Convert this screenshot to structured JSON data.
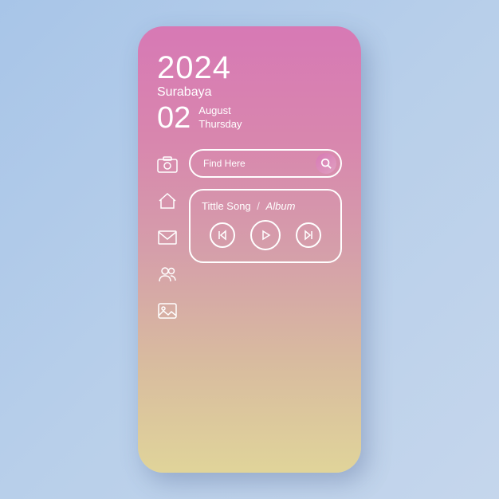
{
  "date": {
    "year": "2024",
    "city": "Surabaya",
    "dayNumber": "02",
    "month": "August",
    "weekday": "Thursday"
  },
  "search": {
    "placeholder": "Find Here"
  },
  "music": {
    "songLabel": "Tittle Song",
    "separator": "/",
    "albumLabel": "Album"
  }
}
